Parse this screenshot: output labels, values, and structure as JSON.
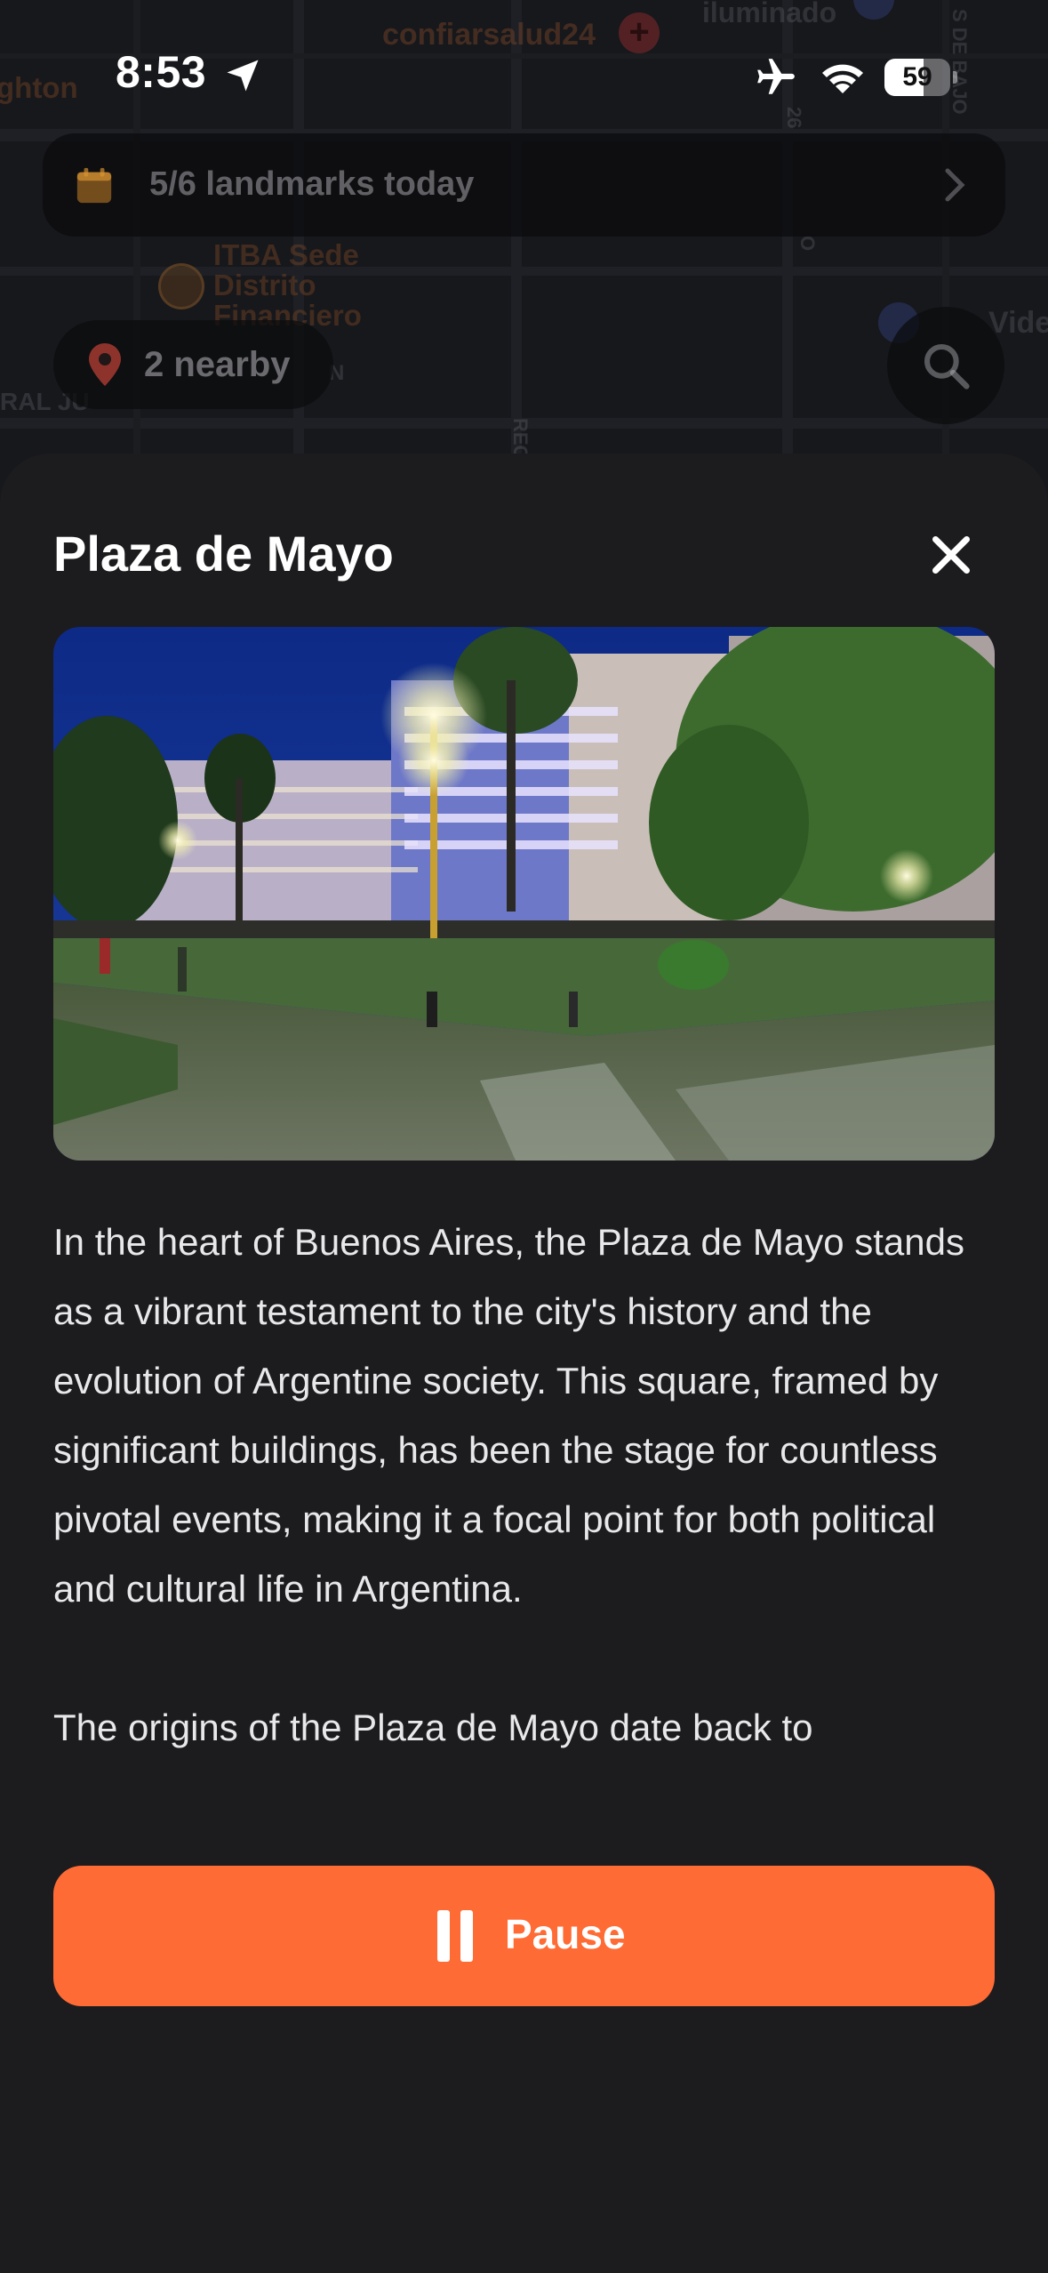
{
  "status_bar": {
    "time": "8:53",
    "battery": "59",
    "battery_level": 0.59
  },
  "map": {
    "labels": {
      "pharmacy": "confiarsalud24",
      "iluminado": "iluminado",
      "ghton": "ghton",
      "itba": "ITBA Sede\nDistrito\nFinanciero",
      "ral": "RAL JU",
      "vide": "Vide",
      "street_26": "26",
      "street_de_bajo": "S DE BAJO",
      "street_rec": "REC",
      "street_o": "O",
      "street_n": "N"
    }
  },
  "landmarks_banner": {
    "text": "5/6 landmarks today"
  },
  "nearby": {
    "text": "2 nearby"
  },
  "sheet": {
    "title": "Plaza de Mayo",
    "description": [
      "In the heart of Buenos Aires, the Plaza de Mayo stands as a vibrant testament to the city's history and the evolution of Argentine society. This square, framed by significant buildings, has been the stage for countless pivotal events, making it a focal point for both political and cultural life in Argentina.",
      "The origins of the Plaza de Mayo date back to"
    ],
    "pause_label": "Pause"
  },
  "colors": {
    "accent": "#ff6b35",
    "sheet_bg": "#1c1c1e",
    "text": "#e8e8ea"
  }
}
